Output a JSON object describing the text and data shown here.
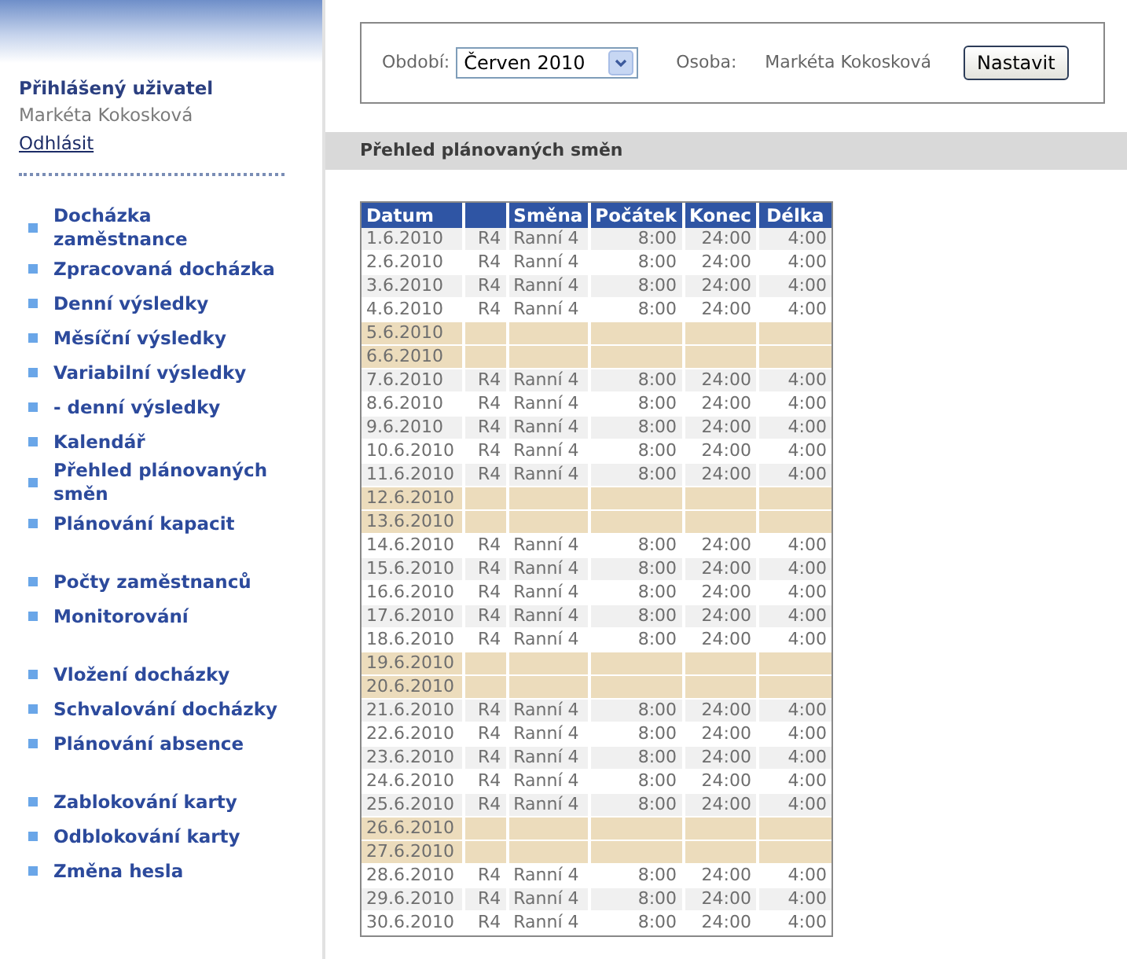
{
  "user": {
    "heading": "Přihlášený uživatel",
    "name": "Markéta Kokosková",
    "logout": "Odhlásit"
  },
  "menu_groups": [
    {
      "items": [
        "Docházka zaměstnance",
        "Zpracovaná docházka",
        "Denní výsledky",
        "Měsíční výsledky",
        "Variabilní výsledky",
        "- denní výsledky",
        "Kalendář",
        "Přehled plánovaných směn",
        "Plánování kapacit"
      ]
    },
    {
      "items": [
        "Počty zaměstnanců",
        "Monitorování"
      ]
    },
    {
      "items": [
        "Vložení docházky",
        "Schvalování docházky",
        "Plánování absence"
      ]
    },
    {
      "items": [
        "Zablokování karty",
        "Odblokování karty",
        "Změna hesla"
      ]
    }
  ],
  "filter": {
    "period_label": "Období:",
    "period_value": "Červen 2010",
    "person_label": "Osoba:",
    "person_value": "Markéta Kokosková",
    "button": "Nastavit"
  },
  "section_title": "Přehled plánovaných směn",
  "table": {
    "columns": [
      "Datum",
      "",
      "Směna",
      "Počátek",
      "Konec",
      "Délka"
    ],
    "rows": [
      {
        "kind": "workday",
        "cells": [
          "1.6.2010",
          "R4",
          "Ranní 4",
          "8:00",
          "24:00",
          "4:00"
        ]
      },
      {
        "kind": "workday",
        "cells": [
          "2.6.2010",
          "R4",
          "Ranní 4",
          "8:00",
          "24:00",
          "4:00"
        ]
      },
      {
        "kind": "workday",
        "cells": [
          "3.6.2010",
          "R4",
          "Ranní 4",
          "8:00",
          "24:00",
          "4:00"
        ]
      },
      {
        "kind": "workday",
        "cells": [
          "4.6.2010",
          "R4",
          "Ranní 4",
          "8:00",
          "24:00",
          "4:00"
        ]
      },
      {
        "kind": "weekend",
        "cells": [
          "5.6.2010"
        ]
      },
      {
        "kind": "weekend",
        "cells": [
          "6.6.2010"
        ]
      },
      {
        "kind": "workday",
        "cells": [
          "7.6.2010",
          "R4",
          "Ranní 4",
          "8:00",
          "24:00",
          "4:00"
        ]
      },
      {
        "kind": "workday",
        "cells": [
          "8.6.2010",
          "R4",
          "Ranní 4",
          "8:00",
          "24:00",
          "4:00"
        ]
      },
      {
        "kind": "workday",
        "cells": [
          "9.6.2010",
          "R4",
          "Ranní 4",
          "8:00",
          "24:00",
          "4:00"
        ]
      },
      {
        "kind": "workday",
        "cells": [
          "10.6.2010",
          "R4",
          "Ranní 4",
          "8:00",
          "24:00",
          "4:00"
        ]
      },
      {
        "kind": "workday",
        "cells": [
          "11.6.2010",
          "R4",
          "Ranní 4",
          "8:00",
          "24:00",
          "4:00"
        ]
      },
      {
        "kind": "weekend",
        "cells": [
          "12.6.2010"
        ]
      },
      {
        "kind": "weekend",
        "cells": [
          "13.6.2010"
        ]
      },
      {
        "kind": "workday",
        "cells": [
          "14.6.2010",
          "R4",
          "Ranní 4",
          "8:00",
          "24:00",
          "4:00"
        ]
      },
      {
        "kind": "workday",
        "cells": [
          "15.6.2010",
          "R4",
          "Ranní 4",
          "8:00",
          "24:00",
          "4:00"
        ]
      },
      {
        "kind": "workday",
        "cells": [
          "16.6.2010",
          "R4",
          "Ranní 4",
          "8:00",
          "24:00",
          "4:00"
        ]
      },
      {
        "kind": "workday",
        "cells": [
          "17.6.2010",
          "R4",
          "Ranní 4",
          "8:00",
          "24:00",
          "4:00"
        ]
      },
      {
        "kind": "workday",
        "cells": [
          "18.6.2010",
          "R4",
          "Ranní 4",
          "8:00",
          "24:00",
          "4:00"
        ]
      },
      {
        "kind": "weekend",
        "cells": [
          "19.6.2010"
        ]
      },
      {
        "kind": "weekend",
        "cells": [
          "20.6.2010"
        ]
      },
      {
        "kind": "workday",
        "cells": [
          "21.6.2010",
          "R4",
          "Ranní 4",
          "8:00",
          "24:00",
          "4:00"
        ]
      },
      {
        "kind": "workday",
        "cells": [
          "22.6.2010",
          "R4",
          "Ranní 4",
          "8:00",
          "24:00",
          "4:00"
        ]
      },
      {
        "kind": "workday",
        "cells": [
          "23.6.2010",
          "R4",
          "Ranní 4",
          "8:00",
          "24:00",
          "4:00"
        ]
      },
      {
        "kind": "workday",
        "cells": [
          "24.6.2010",
          "R4",
          "Ranní 4",
          "8:00",
          "24:00",
          "4:00"
        ]
      },
      {
        "kind": "workday",
        "cells": [
          "25.6.2010",
          "R4",
          "Ranní 4",
          "8:00",
          "24:00",
          "4:00"
        ]
      },
      {
        "kind": "weekend",
        "cells": [
          "26.6.2010"
        ]
      },
      {
        "kind": "weekend",
        "cells": [
          "27.6.2010"
        ]
      },
      {
        "kind": "workday",
        "cells": [
          "28.6.2010",
          "R4",
          "Ranní 4",
          "8:00",
          "24:00",
          "4:00"
        ]
      },
      {
        "kind": "workday",
        "cells": [
          "29.6.2010",
          "R4",
          "Ranní 4",
          "8:00",
          "24:00",
          "4:00"
        ]
      },
      {
        "kind": "workday",
        "cells": [
          "30.6.2010",
          "R4",
          "Ranní 4",
          "8:00",
          "24:00",
          "4:00"
        ]
      }
    ]
  }
}
